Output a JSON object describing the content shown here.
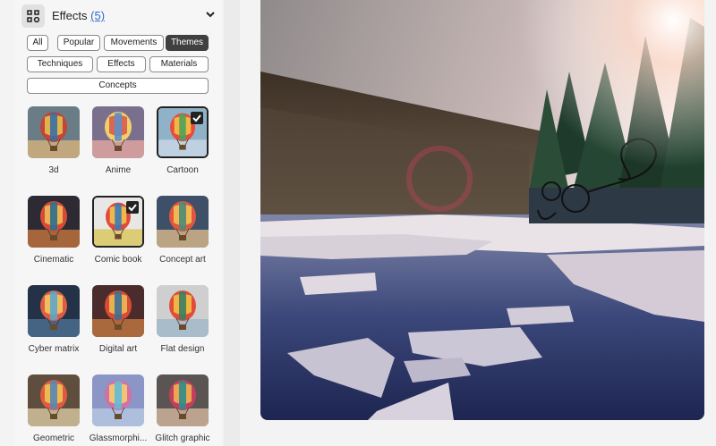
{
  "panel": {
    "title": "Effects",
    "count": "(5)",
    "icons": {
      "header": "effects-grid-icon",
      "collapse": "chevron-down-icon",
      "selected": "checkmark-icon"
    }
  },
  "filters": [
    {
      "label": "All",
      "active": false
    },
    {
      "label": "Popular",
      "active": false
    },
    {
      "label": "Movements",
      "active": false
    },
    {
      "label": "Themes",
      "active": true
    },
    {
      "label": "Techniques",
      "active": false
    },
    {
      "label": "Effects",
      "active": false
    },
    {
      "label": "Materials",
      "active": false
    },
    {
      "label": "Concepts",
      "active": false
    }
  ],
  "effects": [
    {
      "label": "3d",
      "selected": false
    },
    {
      "label": "Anime",
      "selected": false
    },
    {
      "label": "Cartoon",
      "selected": true
    },
    {
      "label": "Cinematic",
      "selected": false
    },
    {
      "label": "Comic book",
      "selected": true
    },
    {
      "label": "Concept art",
      "selected": false
    },
    {
      "label": "Cyber matrix",
      "selected": false
    },
    {
      "label": "Digital art",
      "selected": false
    },
    {
      "label": "Flat design",
      "selected": false
    },
    {
      "label": "Geometric",
      "selected": false
    },
    {
      "label": "Glassmorphi...",
      "selected": false
    },
    {
      "label": "Glitch graphic",
      "selected": false
    }
  ]
}
